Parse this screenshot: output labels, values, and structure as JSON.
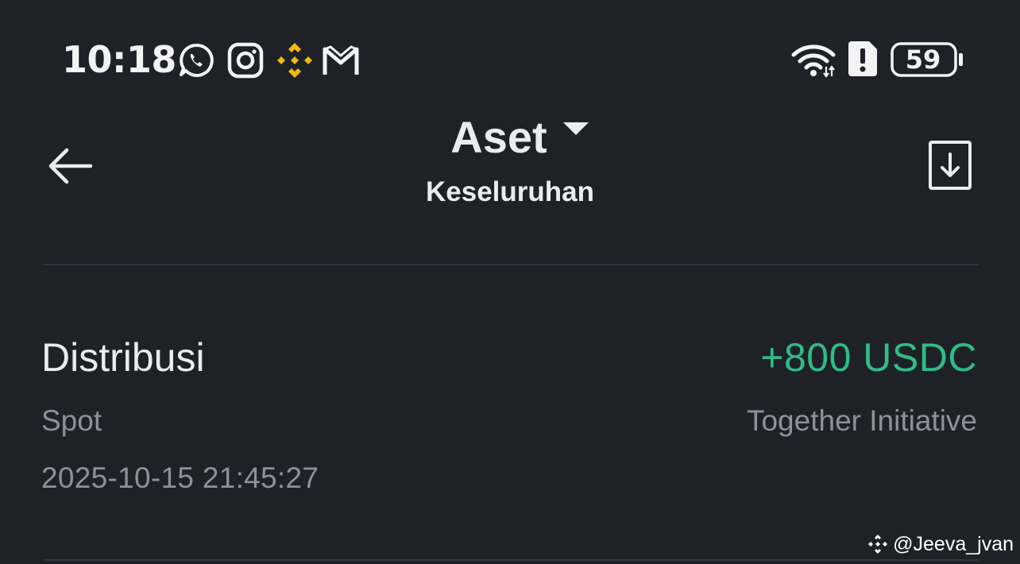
{
  "status_bar": {
    "time": "10:18",
    "notification_icons": [
      "whatsapp-icon",
      "instagram-icon",
      "binance-icon",
      "gmail-icon"
    ],
    "wifi_icon": "wifi-icon",
    "alert_icon": "alert-icon",
    "battery": "59"
  },
  "header": {
    "title": "Aset",
    "subtitle": "Keseluruhan",
    "back_icon": "back-arrow-icon",
    "download_icon": "download-icon"
  },
  "transaction": {
    "type": "Distribusi",
    "amount": "+800 USDC",
    "account": "Spot",
    "source": "Together Initiative",
    "timestamp": "2025-10-15 21:45:27"
  },
  "watermark": {
    "handle": "@Jeeva_jvan"
  },
  "colors": {
    "background": "#1f2128",
    "positive": "#2ebd85",
    "secondary_text": "#8e9199",
    "binance_yellow": "#f0b90b"
  }
}
